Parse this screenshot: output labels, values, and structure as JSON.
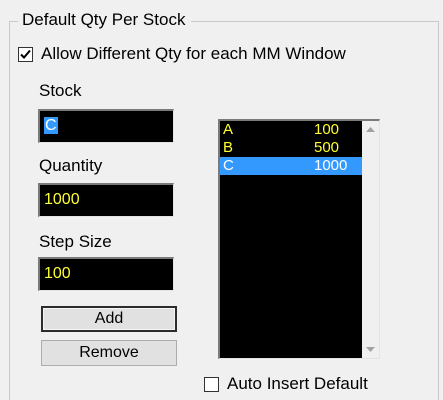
{
  "group": {
    "title": "Default Qty Per Stock"
  },
  "allow_different": {
    "label": "Allow Different Qty for each MM Window",
    "checked": true
  },
  "stock": {
    "label": "Stock",
    "value": "C"
  },
  "quantity": {
    "label": "Quantity",
    "value": "1000"
  },
  "step_size": {
    "label": "Step Size",
    "value": "100"
  },
  "buttons": {
    "add": "Add",
    "remove": "Remove"
  },
  "list": {
    "items": [
      {
        "stock": "A",
        "qty": "100",
        "selected": false
      },
      {
        "stock": "B",
        "qty": "500",
        "selected": false
      },
      {
        "stock": "C",
        "qty": "1000",
        "selected": true
      }
    ]
  },
  "auto_insert": {
    "label": "Auto Insert Default",
    "checked": false
  },
  "colors": {
    "field_bg": "#000000",
    "field_text": "#ffff33",
    "selection": "#3399ff",
    "window_bg": "#f0f0f0"
  },
  "icons": {
    "check": "checkmark-icon",
    "scroll_up": "scroll-up-arrow-icon",
    "scroll_down": "scroll-down-arrow-icon"
  }
}
